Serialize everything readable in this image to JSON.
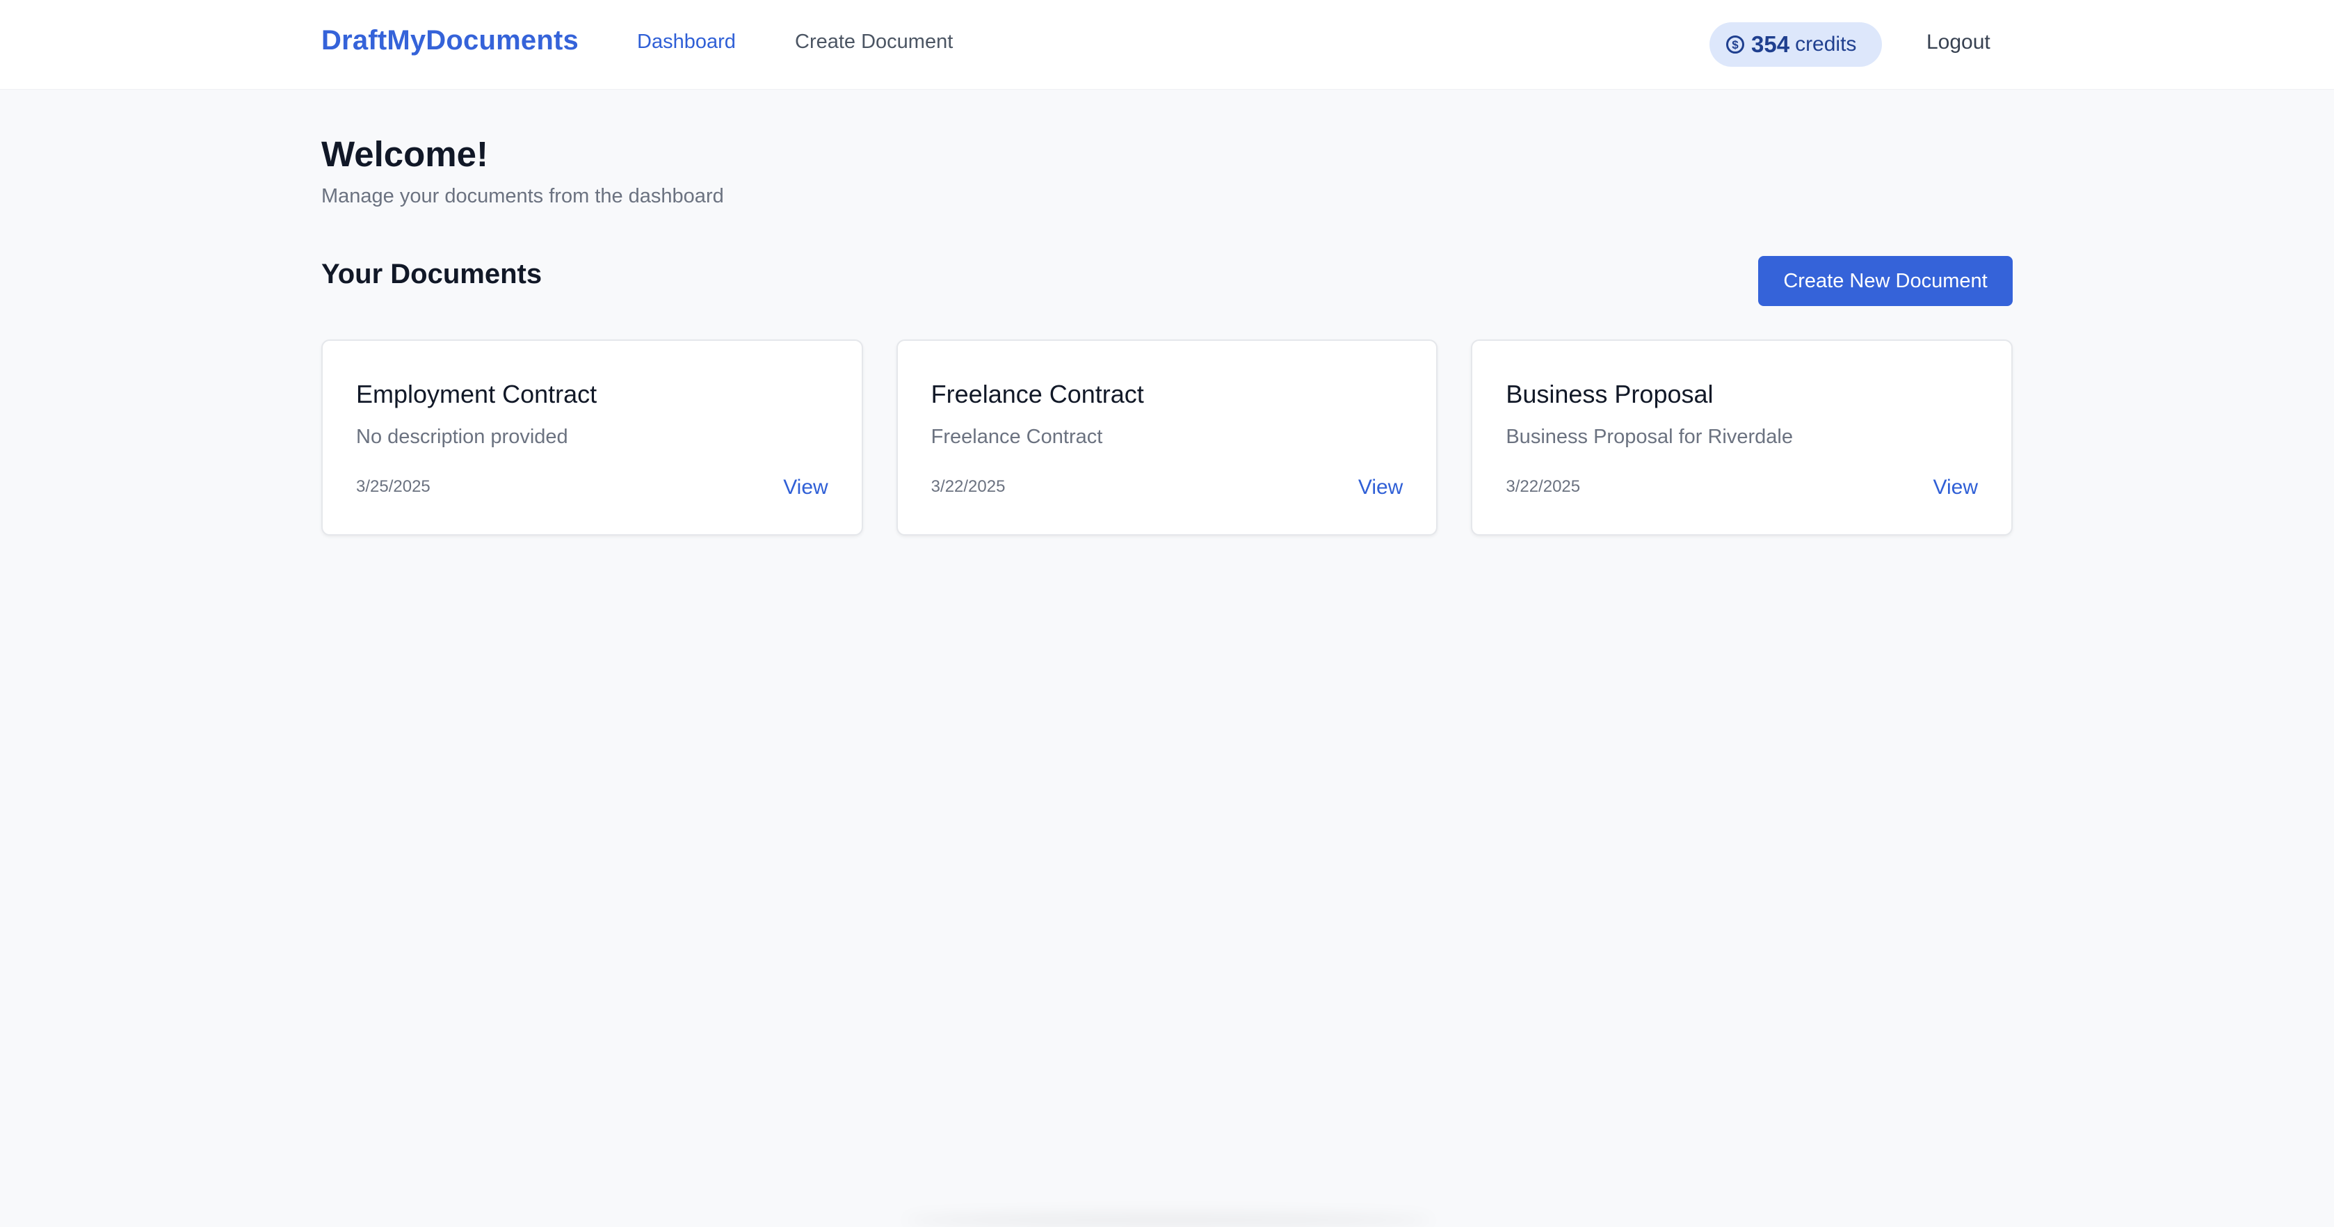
{
  "header": {
    "brand": "DraftMyDocuments",
    "nav": [
      {
        "label": "Dashboard",
        "active": true
      },
      {
        "label": "Create Document",
        "active": false
      }
    ],
    "credits": {
      "count": "354",
      "label": "credits",
      "icon": "coin-dollar-icon"
    },
    "logout_label": "Logout"
  },
  "main": {
    "welcome_title": "Welcome!",
    "welcome_subtitle": "Manage your documents from the dashboard",
    "section_title": "Your Documents",
    "create_button_label": "Create New Document",
    "documents": [
      {
        "title": "Employment Contract",
        "description": "No description provided",
        "date": "3/25/2025",
        "action": "View"
      },
      {
        "title": "Freelance Contract",
        "description": "Freelance Contract",
        "date": "3/22/2025",
        "action": "View"
      },
      {
        "title": "Business Proposal",
        "description": "Business Proposal for Riverdale",
        "date": "3/22/2025",
        "action": "View"
      }
    ]
  },
  "colors": {
    "accent": "#3563d9",
    "page_background": "#f8f9fb",
    "credits_pill": "#dde7fb"
  }
}
